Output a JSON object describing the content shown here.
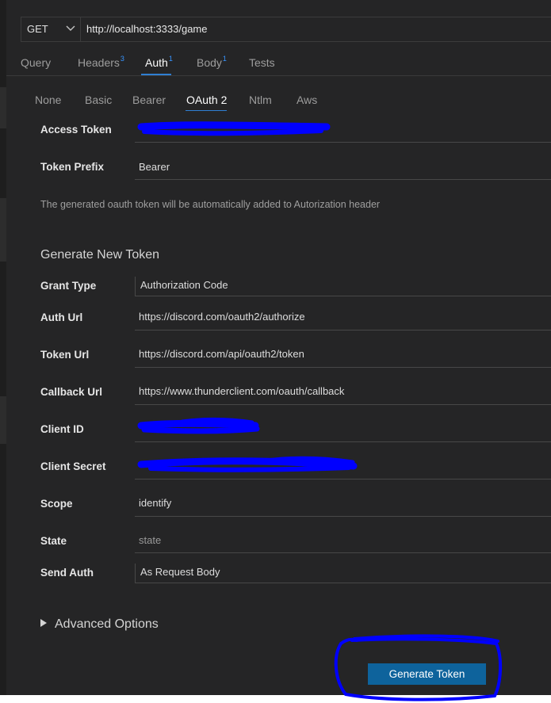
{
  "request": {
    "method": "GET",
    "url": "http://localhost:3333/game"
  },
  "main_tabs": [
    {
      "label": "Query",
      "badge": ""
    },
    {
      "label": "Headers",
      "badge": "3"
    },
    {
      "label": "Auth",
      "badge": "1"
    },
    {
      "label": "Body",
      "badge": "1"
    },
    {
      "label": "Tests",
      "badge": ""
    }
  ],
  "auth_tabs": [
    "None",
    "Basic",
    "Bearer",
    "OAuth 2",
    "Ntlm",
    "Aws"
  ],
  "active_main_tab": "Auth",
  "active_auth_tab": "OAuth 2",
  "fields": {
    "access_token": {
      "label": "Access Token",
      "value": ""
    },
    "token_prefix": {
      "label": "Token Prefix",
      "value": "Bearer"
    },
    "info_text": "The generated oauth token will be automatically added to Autorization header",
    "section_title": "Generate New Token",
    "grant_type": {
      "label": "Grant Type",
      "value": "Authorization Code"
    },
    "auth_url": {
      "label": "Auth Url",
      "value": "https://discord.com/oauth2/authorize"
    },
    "token_url": {
      "label": "Token Url",
      "value": "https://discord.com/api/oauth2/token"
    },
    "callback_url": {
      "label": "Callback Url",
      "value": "https://www.thunderclient.com/oauth/callback"
    },
    "client_id": {
      "label": "Client ID",
      "value": ""
    },
    "client_secret": {
      "label": "Client Secret",
      "value": ""
    },
    "scope": {
      "label": "Scope",
      "value": "identify"
    },
    "state": {
      "label": "State",
      "placeholder": "state"
    },
    "send_auth": {
      "label": "Send Auth",
      "value": "As Request Body"
    }
  },
  "advanced_options_label": "Advanced Options",
  "generate_button_label": "Generate Token",
  "colors": {
    "background": "#252526",
    "accent": "#0e639c",
    "badge": "#3794ff",
    "redaction": "#0000ff"
  }
}
